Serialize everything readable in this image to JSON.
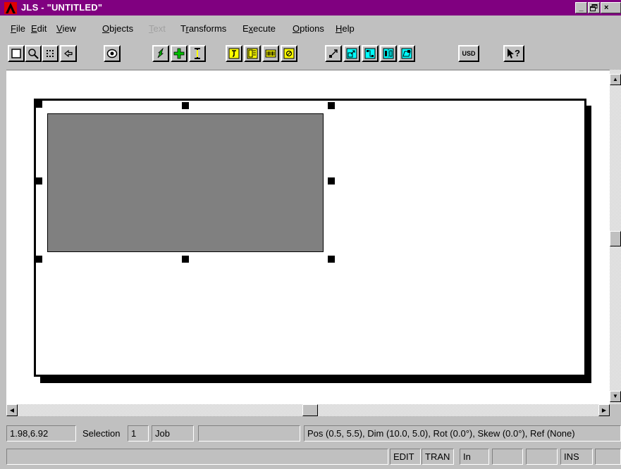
{
  "window": {
    "title": "JLS - \"UNTITLED\"",
    "controls": {
      "minimize": "_",
      "restore": "🗗",
      "close": "×"
    }
  },
  "menu": {
    "items": [
      {
        "label": "File",
        "accel": "F",
        "rest": "ile",
        "enabled": true
      },
      {
        "label": "Edit",
        "accel": "E",
        "rest": "dit",
        "enabled": true
      },
      {
        "label": "View",
        "accel": "V",
        "rest": "iew",
        "enabled": true
      },
      {
        "label": "Objects",
        "accel": "O",
        "rest": "bjects",
        "enabled": true
      },
      {
        "label": "Text",
        "accel": "T",
        "rest": "ext",
        "enabled": false
      },
      {
        "label": "Transforms",
        "accel": "r",
        "rest": "Transforms",
        "enabled": true
      },
      {
        "label": "Execute",
        "accel": "x",
        "rest": "Execute",
        "enabled": true
      },
      {
        "label": "Options",
        "accel": "O",
        "rest": "ptions",
        "enabled": true
      },
      {
        "label": "Help",
        "accel": "H",
        "rest": "elp",
        "enabled": true
      }
    ]
  },
  "toolbar": {
    "buttons": [
      {
        "icon": "new-page-icon"
      },
      {
        "icon": "zoom-icon"
      },
      {
        "icon": "grid-icon"
      },
      {
        "icon": "back-arrow-icon"
      },
      {
        "icon": "preview-eye-icon"
      },
      {
        "icon": "select-pointer-icon"
      },
      {
        "icon": "add-plus-icon"
      },
      {
        "icon": "text-cursor-icon"
      },
      {
        "icon": "text-frame-icon"
      },
      {
        "icon": "multi-field-icon"
      },
      {
        "icon": "barcode-icon"
      },
      {
        "icon": "image-field-icon"
      },
      {
        "icon": "scale-diagonal-icon"
      },
      {
        "icon": "resize-box-icon"
      },
      {
        "icon": "rotate-icon"
      },
      {
        "icon": "mirror-icon"
      },
      {
        "icon": "skew-icon"
      },
      {
        "icon": "usd-icon",
        "label": "USD"
      },
      {
        "icon": "context-help-icon"
      }
    ]
  },
  "status": {
    "coords": "1.98,6.92",
    "selection_label": "Selection",
    "selection_count": "1",
    "mode": "Job",
    "object_info": "Pos (0.5, 5.5), Dim (10.0, 5.0), Rot (0.0°), Skew (0.0°), Ref (None)",
    "edit": "EDIT",
    "tran": "TRAN",
    "units": "In",
    "ins": "INS"
  },
  "colors": {
    "titlebar": "#800080",
    "selected_object": "#808080",
    "toolbar_yellow": "#ffff00",
    "toolbar_cyan": "#00ffff",
    "toolbar_green": "#00c000"
  }
}
